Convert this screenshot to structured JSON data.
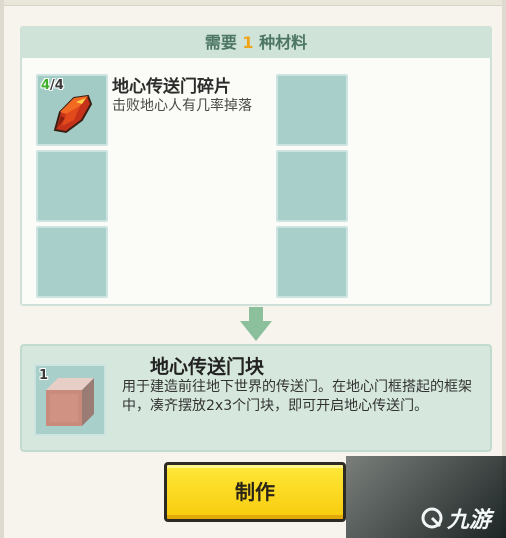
{
  "materials_panel": {
    "header_prefix": "需要 ",
    "header_count": "1",
    "header_suffix": " 种材料",
    "items": [
      {
        "name": "地心传送门碎片",
        "description": "击败地心人有几率掉落",
        "have": "4",
        "separator": "/",
        "need": "4",
        "icon": "red-crystal-shard-icon"
      }
    ]
  },
  "result": {
    "title": "地心传送门块",
    "count": "1",
    "description": "用于建造前往地下世界的传送门。在地心门框搭起的框架中，凑齐摆放2x3个门块，即可开启地心传送门。",
    "icon": "portal-block-cube-icon"
  },
  "craft_button": {
    "label": "制作"
  },
  "watermark": {
    "text": "九游"
  },
  "colors": {
    "header_bg": "#cfe3d9",
    "header_text": "#4d7565",
    "count_accent": "#f0a419",
    "slot_bg": "#a8cfca",
    "button_yellow": "#f7cc0c",
    "have_green": "#3fae2a"
  }
}
